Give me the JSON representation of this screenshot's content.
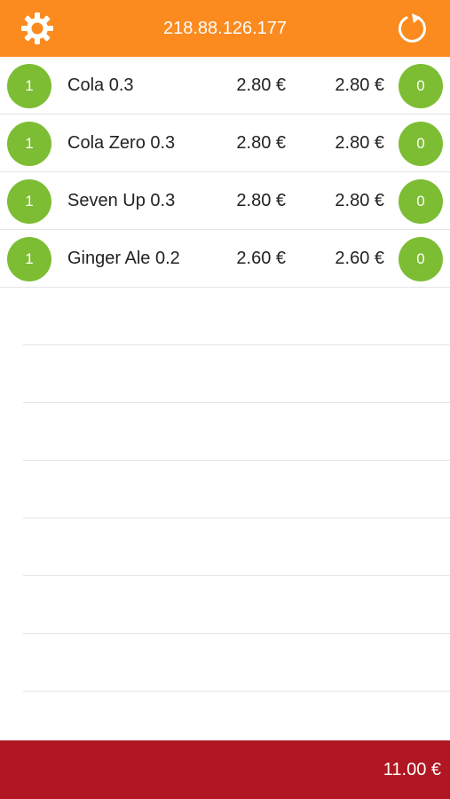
{
  "header": {
    "title": "218.88.126.177",
    "left_icon": "gear-icon",
    "right_icon": "refresh-icon",
    "color": "#fb8a1f"
  },
  "items": [
    {
      "qty": "1",
      "name": "Cola 0.3",
      "unit_price": "2.80 €",
      "total": "2.80 €",
      "counter": "0"
    },
    {
      "qty": "1",
      "name": "Cola Zero 0.3",
      "unit_price": "2.80 €",
      "total": "2.80 €",
      "counter": "0"
    },
    {
      "qty": "1",
      "name": "Seven Up 0.3",
      "unit_price": "2.80 €",
      "total": "2.80 €",
      "counter": "0"
    },
    {
      "qty": "1",
      "name": "Ginger Ale 0.2",
      "unit_price": "2.60 €",
      "total": "2.60 €",
      "counter": "0"
    }
  ],
  "bubble_color": "#7cbd33",
  "footer": {
    "sum": "11.00 €",
    "color": "#b01722"
  }
}
